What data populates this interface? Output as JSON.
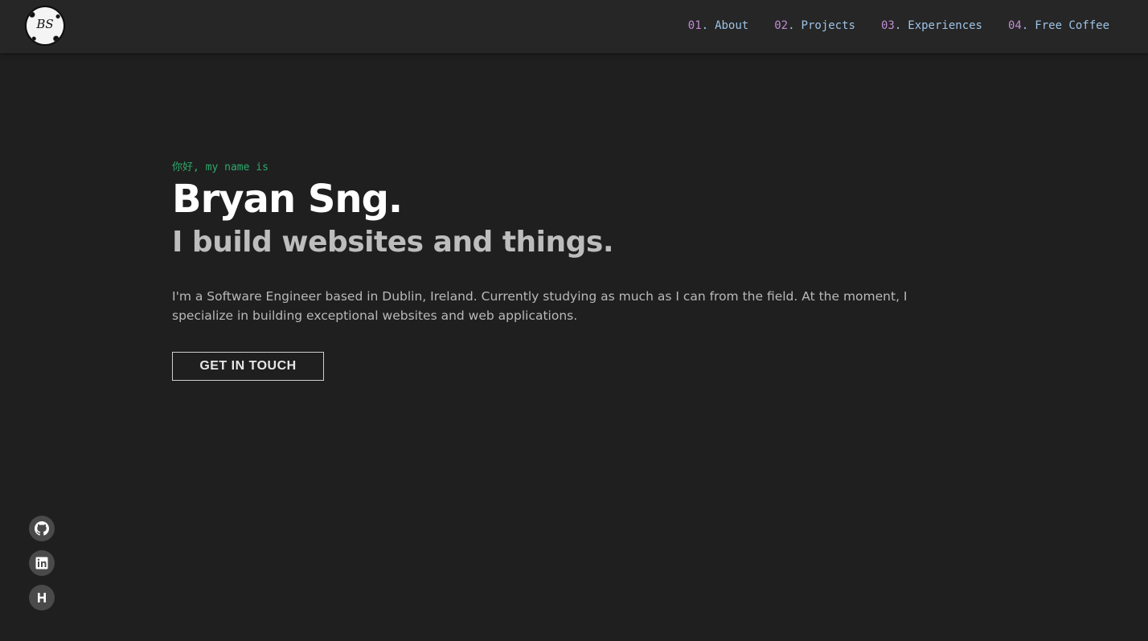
{
  "header": {
    "logo_text": "BS",
    "nav": [
      {
        "num": "01",
        "label": "About"
      },
      {
        "num": "02",
        "label": "Projects"
      },
      {
        "num": "03",
        "label": "Experiences"
      },
      {
        "num": "04",
        "label": "Free Coffee"
      }
    ]
  },
  "hero": {
    "greeting": "你好, my name is",
    "name": "Bryan Sng.",
    "tagline": "I build websites and things.",
    "bio": "I'm a Software Engineer based in Dublin, Ireland. Currently studying as much as I can from the field. At the moment, I specialize in building exceptional websites and web applications.",
    "cta_label": "GET IN TOUCH"
  },
  "socials": [
    {
      "icon": "github-icon"
    },
    {
      "icon": "linkedin-icon"
    },
    {
      "icon": "hashnode-icon"
    }
  ],
  "colors": {
    "background": "#1f1f1f",
    "header": "#262626",
    "nav_number": "#c08bd1",
    "nav_label": "#9ec3e6",
    "greeting": "#2eaa6b",
    "name": "#ffffff",
    "tagline": "#bdbdbd",
    "bio": "#b9b9b9"
  }
}
